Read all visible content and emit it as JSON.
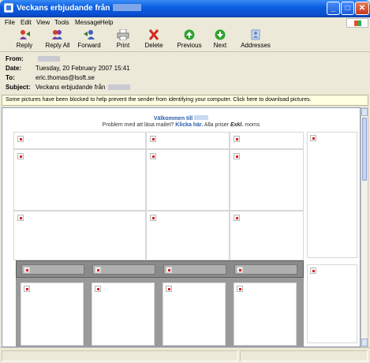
{
  "window": {
    "title": "Veckans erbjudande från",
    "buttons": {
      "minimize": "_",
      "maximize": "□",
      "close": "✕"
    }
  },
  "menu": [
    "File",
    "Edit",
    "View",
    "Tools",
    "Message",
    "Help"
  ],
  "toolbar": [
    {
      "label": "Reply",
      "icon": "reply-icon"
    },
    {
      "label": "Reply All",
      "icon": "reply-all-icon"
    },
    {
      "label": "Forward",
      "icon": "forward-icon"
    },
    {
      "label": "Print",
      "icon": "printer-icon"
    },
    {
      "label": "Delete",
      "icon": "delete-x-icon"
    },
    {
      "label": "Previous",
      "icon": "previous-arrow-icon"
    },
    {
      "label": "Next",
      "icon": "next-arrow-icon"
    },
    {
      "label": "Addresses",
      "icon": "address-book-icon"
    }
  ],
  "headers": {
    "from_label": "From:",
    "from_value": "",
    "date_label": "Date:",
    "date_value": "Tuesday, 20 February 2007 15:41",
    "to_label": "To:",
    "to_value": "eric.thomas@lsoft.se",
    "subject_label": "Subject:",
    "subject_value": "Veckans erbjudande från"
  },
  "infobar": {
    "text": "Some pictures have been blocked to help prevent the sender from identifying your computer. Click here to download pictures."
  },
  "email": {
    "welcome": "Välkommen till",
    "line2_a": "Problem med att läsa mailet?",
    "line2_link": "Klicka här.",
    "line2_b": "Alla priser",
    "line2_bold": "Exkl.",
    "line2_c": "moms"
  },
  "colors": {
    "title_blue": "#0a5fe0",
    "link_blue": "#2a5ea8",
    "infobar_bg": "#ffffe1",
    "category_gray": "#8a8a8a"
  }
}
